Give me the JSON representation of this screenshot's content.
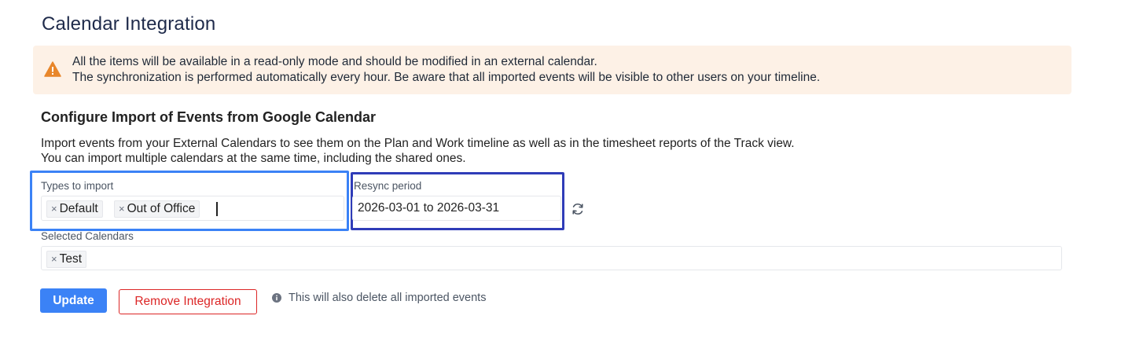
{
  "page": {
    "title": "Calendar Integration"
  },
  "alert": {
    "icon": "warning-icon",
    "line1": "All the items will be available in a read-only mode and should be modified in an external calendar.",
    "line2": "The synchronization is performed automatically every hour. Be aware that all imported events will be visible to other users on your timeline.",
    "background": "#fdf1e6",
    "icon_color": "#e8862a"
  },
  "section": {
    "title": "Configure Import of Events from Google Calendar",
    "desc1": "Import events from your External Calendars to see them on the Plan and Work timeline as well as in the timesheet reports of the Track view.",
    "desc2": "You can import multiple calendars at the same time, including the shared ones."
  },
  "types": {
    "label": "Types to import",
    "tags": [
      "Default",
      "Out of Office"
    ],
    "remove_glyph": "×"
  },
  "resync": {
    "label": "Resync period",
    "value": "2026-03-01 to 2026-03-31",
    "icon": "refresh-icon"
  },
  "calendars": {
    "label": "Selected Calendars",
    "tags": [
      "Test"
    ]
  },
  "actions": {
    "update_label": "Update",
    "remove_label": "Remove Integration",
    "info_text": "This will also delete all imported events",
    "primary_color": "#3b82f6",
    "danger_color": "#dc2626"
  },
  "highlights": {
    "types_box_color": "#3b82f6",
    "resync_box_color": "#2f3cb8"
  }
}
